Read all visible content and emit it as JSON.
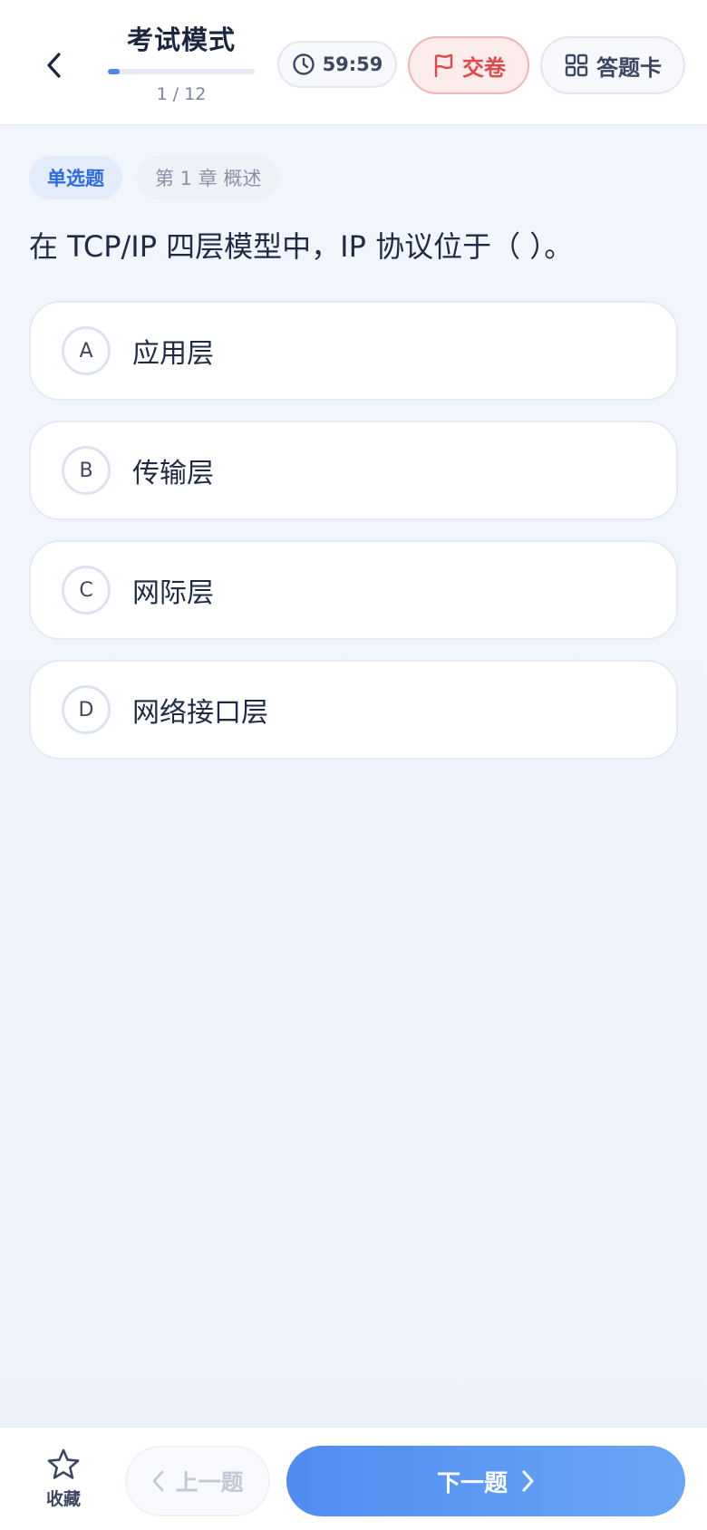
{
  "header": {
    "title": "考试模式",
    "progress": {
      "current": 1,
      "total": 12,
      "label": "1 / 12",
      "fraction": 0.0833
    },
    "timer": "59:59",
    "submit_label": "交卷",
    "answer_card_label": "答题卡"
  },
  "question": {
    "type_tag": "单选题",
    "chapter_tag": "第 1 章 概述",
    "text": "在 TCP/IP 四层模型中，IP 协议位于（ ）。",
    "options": [
      {
        "letter": "A",
        "text": "应用层"
      },
      {
        "letter": "B",
        "text": "传输层"
      },
      {
        "letter": "C",
        "text": "网际层"
      },
      {
        "letter": "D",
        "text": "网络接口层"
      }
    ]
  },
  "bottom": {
    "favorite_label": "收藏",
    "prev_label": "上一题",
    "next_label": "下一题"
  },
  "colors": {
    "accent": "#4a86ef",
    "danger": "#e2474b",
    "text_primary": "#1f2a44"
  }
}
